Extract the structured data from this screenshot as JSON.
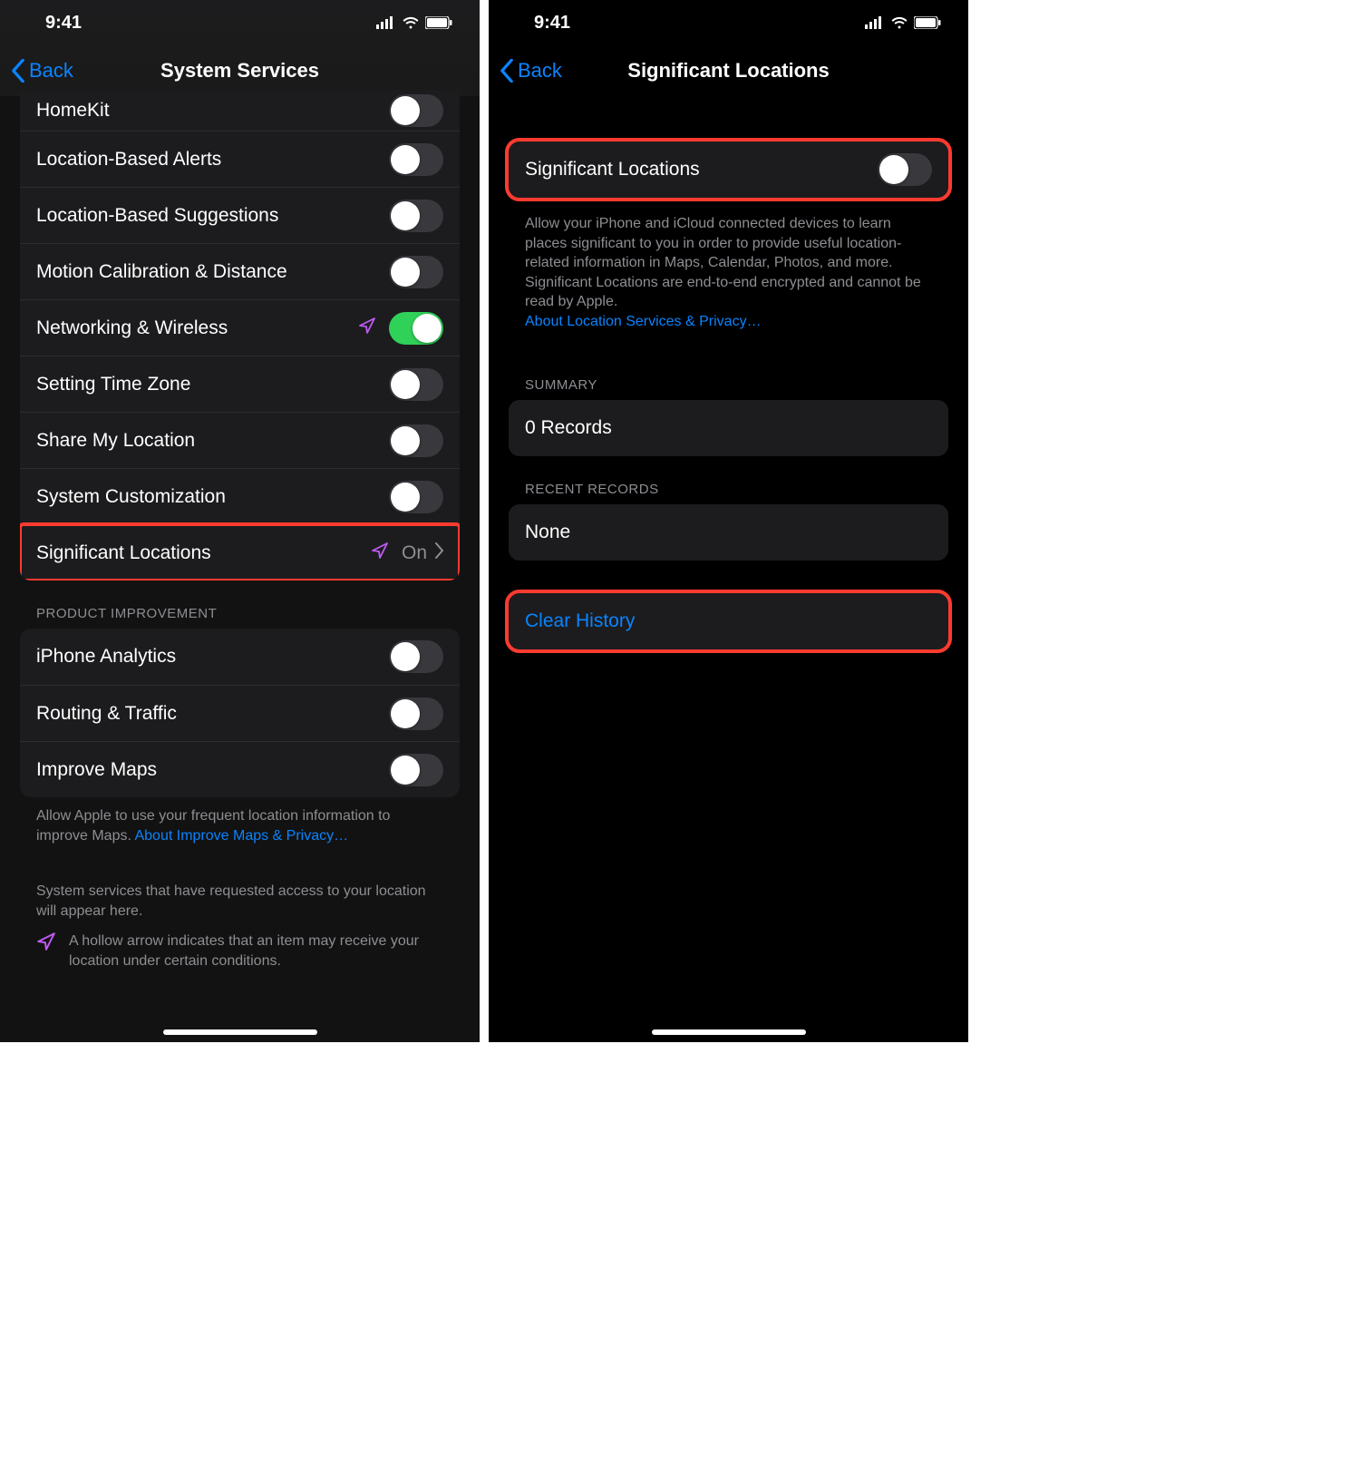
{
  "status": {
    "time": "9:41"
  },
  "left": {
    "back": "Back",
    "title": "System Services",
    "rows1": [
      {
        "label": "HomeKit",
        "toggle": false
      },
      {
        "label": "Location-Based Alerts",
        "toggle": false
      },
      {
        "label": "Location-Based Suggestions",
        "toggle": false
      },
      {
        "label": "Motion Calibration & Distance",
        "toggle": false
      },
      {
        "label": "Networking & Wireless",
        "toggle": true,
        "loc": true
      },
      {
        "label": "Setting Time Zone",
        "toggle": false
      },
      {
        "label": "Share My Location",
        "toggle": false
      },
      {
        "label": "System Customization",
        "toggle": false
      }
    ],
    "sigloc": {
      "label": "Significant Locations",
      "value": "On"
    },
    "section2": "PRODUCT IMPROVEMENT",
    "rows2": [
      {
        "label": "iPhone Analytics",
        "toggle": false
      },
      {
        "label": "Routing & Traffic",
        "toggle": false
      },
      {
        "label": "Improve Maps",
        "toggle": false
      }
    ],
    "footer1": "Allow Apple to use your frequent location information to improve Maps. ",
    "footer1_link": "About Improve Maps & Privacy…",
    "footer2": "System services that have requested access to your location will appear here.",
    "legend": "A hollow arrow indicates that an item may receive your location under certain conditions."
  },
  "right": {
    "back": "Back",
    "title": "Significant Locations",
    "toggle_label": "Significant Locations",
    "desc": "Allow your iPhone and iCloud connected devices to learn places significant to you in order to provide useful location-related information in Maps, Calendar, Photos, and more. Significant Locations are end-to-end encrypted and cannot be read by Apple.",
    "desc_link": "About Location Services & Privacy…",
    "summary_header": "SUMMARY",
    "summary_value": "0 Records",
    "recent_header": "RECENT RECORDS",
    "recent_value": "None",
    "clear": "Clear History"
  }
}
